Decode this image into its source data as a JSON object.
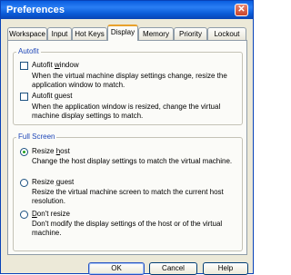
{
  "window": {
    "title": "Preferences"
  },
  "tabs": [
    {
      "label": "Workspace"
    },
    {
      "label": "Input"
    },
    {
      "label": "Hot Keys"
    },
    {
      "label": "Display",
      "active": true
    },
    {
      "label": "Memory"
    },
    {
      "label": "Priority"
    },
    {
      "label": "Lockout"
    }
  ],
  "autofit": {
    "legend": "Autofit",
    "window": {
      "label": "Autofit window",
      "checked": false,
      "description": "When the virtual machine display settings change, resize the application window to match."
    },
    "guest": {
      "label": "Autofit guest",
      "checked": false,
      "description": "When the application window is resized, change the virtual machine display settings to match."
    }
  },
  "fullscreen": {
    "legend": "Full Screen",
    "selected": "resize_host",
    "resize_host": {
      "label": "Resize host",
      "description": "Change the host display settings to match the virtual machine."
    },
    "resize_guest": {
      "label": "Resize guest",
      "description": "Resize the virtual machine screen to match the current host resolution."
    },
    "dont_resize": {
      "label": "Don't resize",
      "description": "Don't modify the display settings of the host or of the virtual machine."
    }
  },
  "buttons": {
    "ok": "OK",
    "cancel": "Cancel",
    "help": "Help"
  },
  "colors": {
    "title_bar": "#0a5ee0",
    "group_legend": "#1f47b8",
    "active_tab_accent": "#e8a12c",
    "radio_dot": "#21a121"
  }
}
